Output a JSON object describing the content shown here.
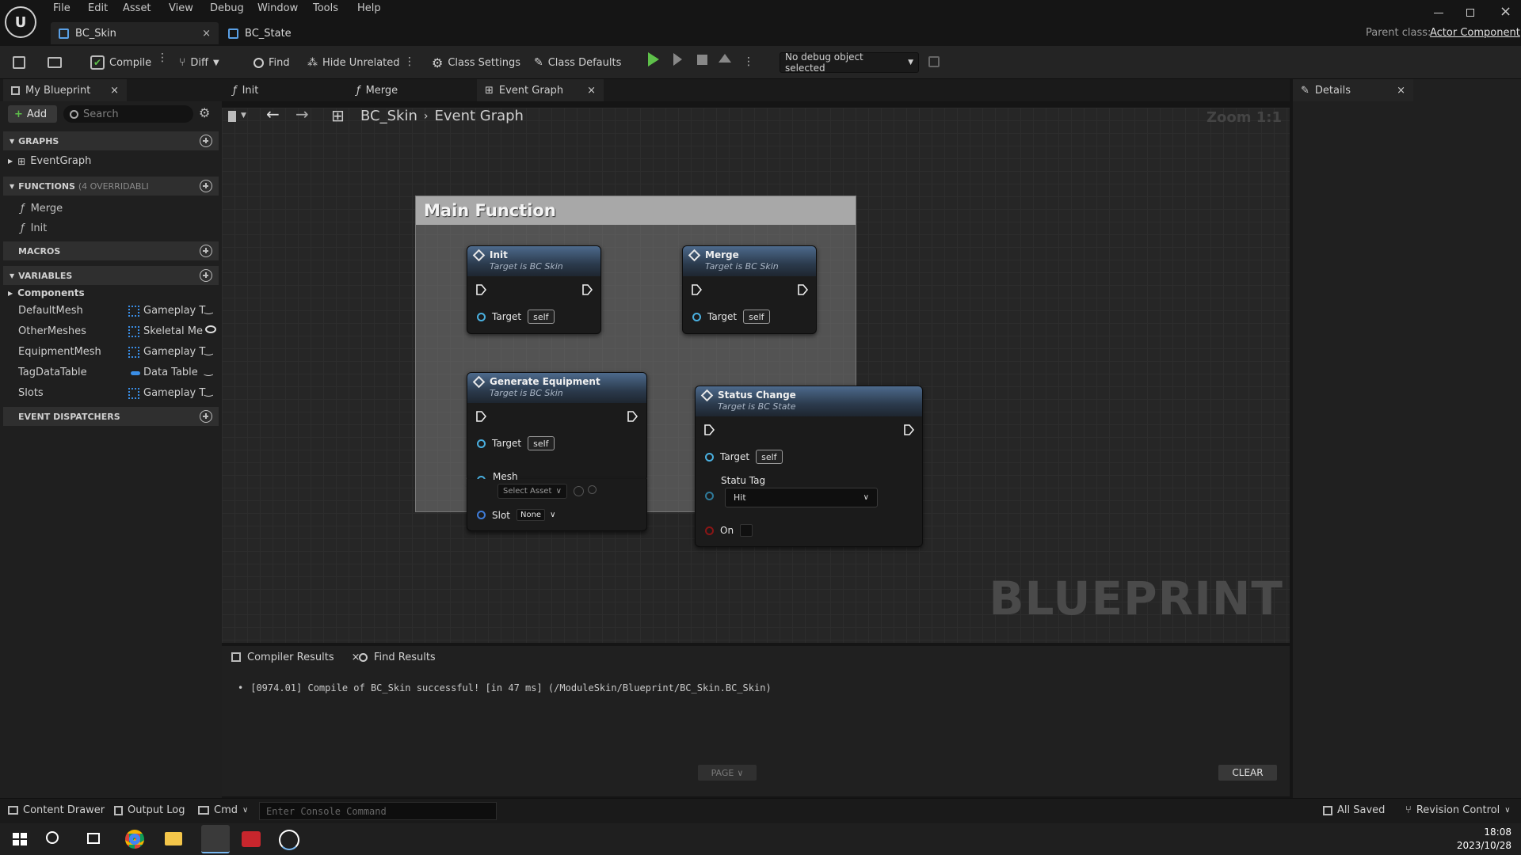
{
  "menu": [
    "File",
    "Edit",
    "Asset",
    "View",
    "Debug",
    "Window",
    "Tools",
    "Help"
  ],
  "doc_tabs": [
    {
      "label": "BC_Skin"
    },
    {
      "label": "BC_State"
    }
  ],
  "parent_class": {
    "label": "Parent class:",
    "value": "Actor Component"
  },
  "toolbar": {
    "compile": "Compile",
    "diff": "Diff",
    "find": "Find",
    "hide_unrelated": "Hide Unrelated",
    "class_settings": "Class Settings",
    "class_defaults": "Class Defaults",
    "debug_object": "No debug object selected"
  },
  "my_blueprint": {
    "tab": "My Blueprint",
    "add": "Add",
    "search_placeholder": "Search",
    "graphs_header": "GRAPHS",
    "event_graph": "EventGraph",
    "functions_header": "FUNCTIONS",
    "functions_count": "(4 OVERRIDABLI",
    "functions": [
      "Merge",
      "Init"
    ],
    "macros_header": "MACROS",
    "variables_header": "VARIABLES",
    "components": "Components",
    "variables": [
      {
        "name": "DefaultMesh",
        "type": "Gameplay T"
      },
      {
        "name": "OtherMeshes",
        "type": "Skeletal Me"
      },
      {
        "name": "EquipmentMesh",
        "type": "Gameplay T"
      },
      {
        "name": "TagDataTable",
        "type": "Data Table"
      },
      {
        "name": "Slots",
        "type": "Gameplay T"
      }
    ],
    "dispatchers_header": "EVENT DISPATCHERS"
  },
  "graph_tabs": [
    "Init",
    "Merge",
    "Event Graph"
  ],
  "breadcrumb": {
    "root": "BC_Skin",
    "current": "Event Graph"
  },
  "zoom": "Zoom 1:1",
  "watermark": "BLUEPRINT",
  "comment": {
    "title": "Main Function"
  },
  "nodes": {
    "init": {
      "title": "Init",
      "sub": "Target is BC Skin",
      "target": "Target",
      "self": "self"
    },
    "merge": {
      "title": "Merge",
      "sub": "Target is BC Skin",
      "target": "Target",
      "self": "self"
    },
    "gen": {
      "title": "Generate Equipment",
      "sub": "Target is BC Skin",
      "target": "Target",
      "self": "self",
      "mesh": "Mesh",
      "mesh_value": "Select Asset",
      "slot": "Slot",
      "slot_value": "None"
    },
    "status": {
      "title": "Status Change",
      "sub": "Target is BC State",
      "target": "Target",
      "self": "self",
      "tag": "Statu Tag",
      "tag_value": "Hit",
      "on": "On"
    }
  },
  "details": {
    "tab": "Details"
  },
  "bottom": {
    "compiler_tab": "Compiler Results",
    "find_tab": "Find Results",
    "log": "[0974.01] Compile of BC_Skin successful! [in 47 ms] (/ModuleSkin/Blueprint/BC_Skin.BC_Skin)",
    "page": "PAGE",
    "clear": "CLEAR"
  },
  "status": {
    "content_drawer": "Content Drawer",
    "output_log": "Output Log",
    "cmd": "Cmd",
    "console_placeholder": "Enter Console Command",
    "all_saved": "All Saved",
    "revision": "Revision Control"
  },
  "clock": {
    "time": "18:08",
    "date": "2023/10/28"
  }
}
